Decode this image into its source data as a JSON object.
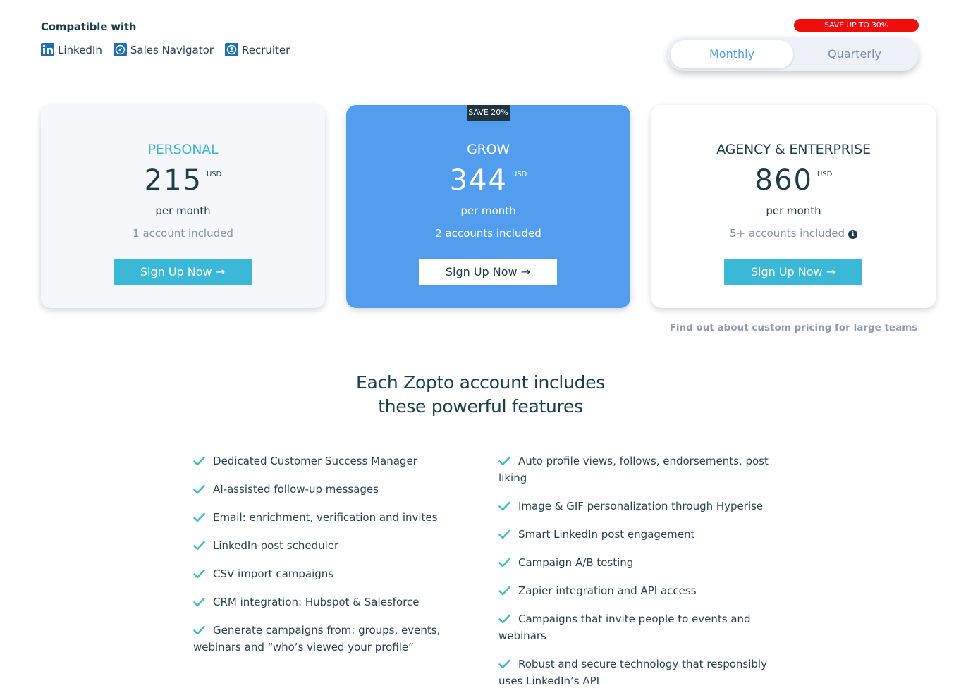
{
  "compatible": {
    "title": "Compatible with",
    "items": [
      {
        "label": "LinkedIn",
        "icon": "linkedin-icon"
      },
      {
        "label": "Sales Navigator",
        "icon": "sales-navigator-icon"
      },
      {
        "label": "Recruiter",
        "icon": "recruiter-icon"
      }
    ]
  },
  "billing": {
    "save_banner": "SAVE UP TO 30%",
    "options": [
      "Monthly",
      "Quarterly"
    ],
    "selected": "Monthly"
  },
  "plans": [
    {
      "name": "PERSONAL",
      "price": "215",
      "currency": "USD",
      "period": "per month",
      "accounts": "1 account included",
      "cta": "Sign Up Now →"
    },
    {
      "name": "GROW",
      "price": "344",
      "currency": "USD",
      "period": "per month",
      "accounts": "2 accounts included",
      "cta": "Sign Up Now →",
      "tag": "SAVE 20%"
    },
    {
      "name": "AGENCY & ENTERPRISE",
      "price": "860",
      "currency": "USD",
      "period": "per month",
      "accounts": "5+ accounts included",
      "cta": "Sign Up Now →"
    }
  ],
  "custom_pricing_link": "Find out about custom pricing for large teams",
  "features": {
    "title_line1": "Each Zopto account includes",
    "title_line2": "these powerful features",
    "left": [
      "Dedicated Customer Success Manager",
      "AI-assisted follow-up messages",
      "Email: enrichment, verification and invites",
      "LinkedIn post scheduler",
      "CSV import campaigns",
      "CRM integration: Hubspot & Salesforce",
      "Generate campaigns from: groups, events, webinars and “who’s viewed your profile”"
    ],
    "right": [
      "Auto profile views, follows, endorsements, post liking",
      "Image & GIF personalization through Hyperise",
      "Smart LinkedIn post engagement",
      "Campaign A/B testing",
      "Zapier integration and API access",
      "Campaigns that invite people to events and webinars",
      "Robust and secure technology that responsibly uses LinkedIn’s API"
    ]
  },
  "colors": {
    "accent": "#3bb7d8",
    "grow_card": "#529dee",
    "save_red": "#f20b0b",
    "check": "#48b8c8"
  }
}
